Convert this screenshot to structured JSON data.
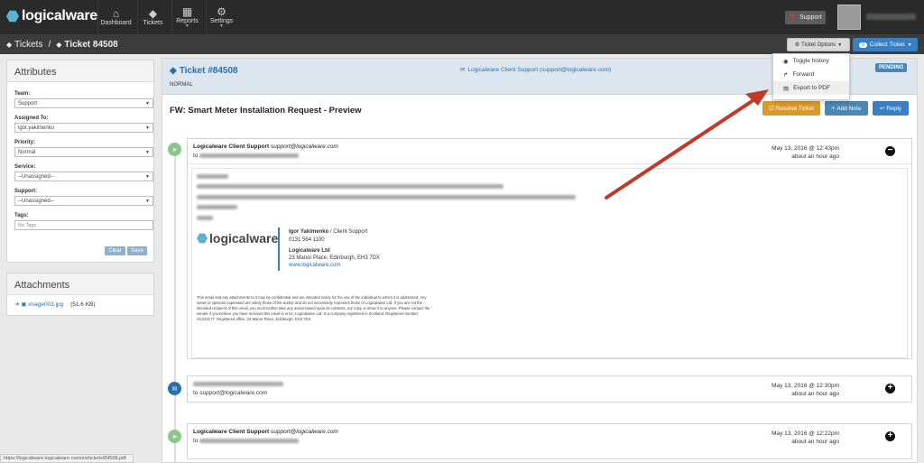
{
  "brand": {
    "name": "logicalware"
  },
  "nav": [
    {
      "label": "Dashboard",
      "icon": "home-icon"
    },
    {
      "label": "Tickets",
      "icon": "tags-icon"
    },
    {
      "label": "Reports",
      "icon": "chart-icon"
    },
    {
      "label": "Settings",
      "icon": "gear-icon"
    }
  ],
  "topbar": {
    "support_label": "Support"
  },
  "breadcrumb": {
    "tickets": "Tickets",
    "separator": "/",
    "current": "Ticket 84508"
  },
  "toolbar": {
    "ticket_options_label": "Ticket Options",
    "collect_label": "Collect Ticket",
    "collect_count": "0"
  },
  "dropdown": {
    "items": [
      "Toggle history",
      "Forward",
      "Export to PDF"
    ]
  },
  "attributes": {
    "title": "Attributes",
    "team_label": "Team:",
    "team_value": "Support",
    "assigned_label": "Assigned To:",
    "assigned_value": "igor.yakimenko",
    "priority_label": "Priority:",
    "priority_value": "Normal",
    "service_label": "Service:",
    "service_value": "--Unassigned--",
    "support_label": "Support:",
    "support_value": "--Unassigned--",
    "tags_label": "Tags:",
    "tags_placeholder": "No Tags",
    "clear_label": "Clear",
    "save_label": "Save"
  },
  "attachments": {
    "title": "Attachments",
    "file_name": "image003.jpg",
    "file_size": "(51.6 KB)"
  },
  "ticket": {
    "id": "Ticket #84508",
    "priority": "NORMAL",
    "from": "Logicalware Client Support (support@logicalware.com)",
    "status": "PENDING",
    "subject": "FW: Smart Meter Installation Request - Preview",
    "resolve_label": "Resolve Ticket",
    "add_note_label": "Add Note",
    "reply_label": "Reply"
  },
  "messages": [
    {
      "sender": "Logicalware Client Support",
      "email": "support@logicalware.com",
      "to_prefix": "to",
      "to": "",
      "date": "May 13, 2016 @ 12:43pm",
      "ago": "about an hour ago",
      "toggle": "−"
    },
    {
      "sender": "",
      "email": "",
      "to_prefix": "to",
      "to": "support@logicalware.com",
      "date": "May 13, 2016 @ 12:30pm",
      "ago": "about an hour ago",
      "toggle": "+"
    },
    {
      "sender": "Logicalware Client Support",
      "email": "support@logicalware.com",
      "to_prefix": "to",
      "to": "",
      "date": "May 13, 2016 @ 12:22pm",
      "ago": "about an hour ago",
      "toggle": "+"
    }
  ],
  "signature": {
    "logo": "logicalware",
    "name": "Igor Yakimenko",
    "role": " / Client Support",
    "phone": "0131 564 1100",
    "company": "Logicalware Ltd",
    "address": "23 Manor Place, Edinburgh, EH3 7DX",
    "website": "www.logicalware.com"
  },
  "disclaimer": "This email and any attachments to it may be confidential and are intended solely for the use of the individual to whom it is addressed. Any views or opinions expressed are solely those of the author and do not necessarily represent those of Logicalware Ltd. If you are not the intended recipient of this email, you must neither take any action based upon its contents, nor copy or show it to anyone. Please contact the sender if you believe you have received this email in error. Logicalware Ltd. is a company registered in Scotland. Registered number: SC234177. Registered office: 23 Manor Place, Edinburgh, EH3 7DX.",
  "status_url": "https://logicalware.logicalware.com/en/tickets/84508.pdf",
  "colors": {
    "accent": "#3a7fc1",
    "resolve": "#d89a2c",
    "add_note": "#4b86b4",
    "pending": "#4b86b4",
    "topbar": "#2b2b2b",
    "annotation_arrow": "#c0392b"
  }
}
